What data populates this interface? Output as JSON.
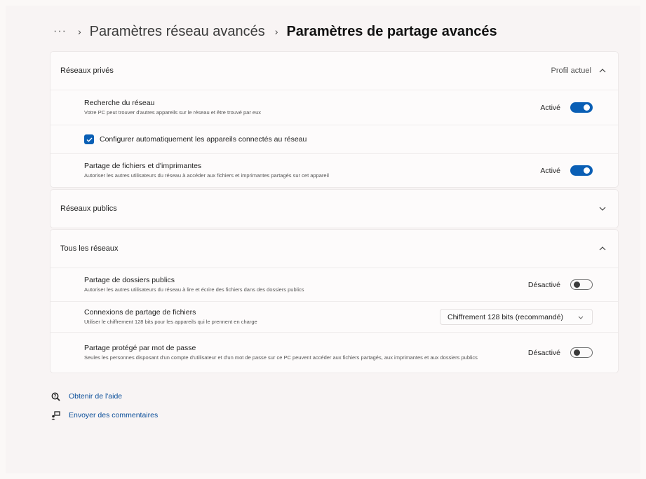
{
  "breadcrumb": {
    "more": "···",
    "previous": "Paramètres réseau avancés",
    "current": "Paramètres de partage avancés"
  },
  "private_networks": {
    "title": "Réseaux privés",
    "badge": "Profil actuel",
    "network_discovery": {
      "title": "Recherche du réseau",
      "description": "Votre PC peut trouver d'autres appareils sur le réseau et être trouvé par eux",
      "state": "Activé"
    },
    "auto_setup": {
      "label": "Configurer automatiquement les appareils connectés au réseau",
      "checked": true
    },
    "file_printer_sharing": {
      "title": "Partage de fichiers et d'imprimantes",
      "description": "Autoriser les autres utilisateurs du réseau à accéder aux fichiers et imprimantes partagés sur cet appareil",
      "state": "Activé"
    }
  },
  "public_networks": {
    "title": "Réseaux publics"
  },
  "all_networks": {
    "title": "Tous les réseaux",
    "public_folder_sharing": {
      "title": "Partage de dossiers publics",
      "description": "Autoriser les autres utilisateurs du réseau à lire et écrire des fichiers dans des dossiers publics",
      "state": "Désactivé"
    },
    "file_sharing_connections": {
      "title": "Connexions de partage de fichiers",
      "description": "Utiliser le chiffrement 128 bits pour les appareils qui le prennent en charge",
      "selected": "Chiffrement 128 bits (recommandé)"
    },
    "password_protected_sharing": {
      "title": "Partage protégé par mot de passe",
      "description": "Seules les personnes disposant d'un compte d'utilisateur et d'un mot de passe sur ce PC peuvent accéder aux fichiers partagés, aux imprimantes et aux dossiers publics",
      "state": "Désactivé"
    }
  },
  "footer": {
    "help": "Obtenir de l'aide",
    "feedback": "Envoyer des commentaires"
  },
  "colors": {
    "accent": "#0a5fb5",
    "link": "#0a4e9a"
  }
}
